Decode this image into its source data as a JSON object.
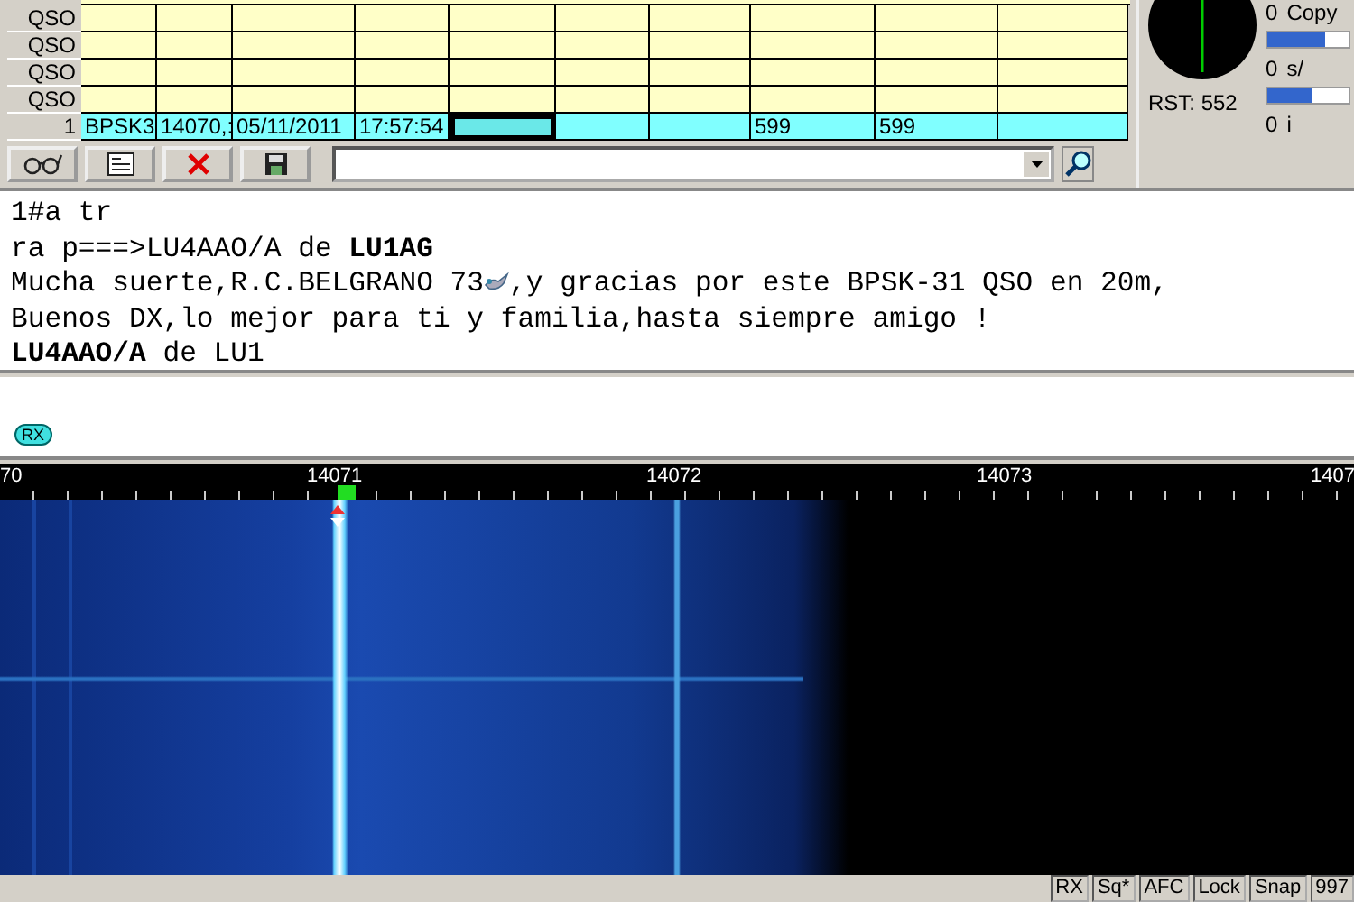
{
  "log_grid": {
    "rows": [
      {
        "label": "QSO",
        "selected": false,
        "cells": [
          {},
          {},
          {},
          {},
          {},
          {},
          {},
          {},
          {},
          {}
        ]
      },
      {
        "label": "QSO",
        "selected": false,
        "cells": [
          {},
          {},
          {},
          {},
          {},
          {},
          {},
          {},
          {},
          {}
        ]
      },
      {
        "label": "QSO",
        "selected": false,
        "cells": [
          {},
          {},
          {},
          {},
          {},
          {},
          {},
          {},
          {},
          {}
        ]
      },
      {
        "label": "QSO",
        "selected": false,
        "cells": [
          {},
          {},
          {},
          {},
          {},
          {},
          {},
          {},
          {},
          {}
        ]
      },
      {
        "label": "1",
        "selected": true,
        "cells": [
          {
            "text": "BPSK3",
            "focused": false
          },
          {
            "text": "14070,:",
            "focused": false
          },
          {
            "text": "05/11/2011",
            "focused": false
          },
          {
            "text": "17:57:54",
            "focused": false
          },
          {
            "focused": true
          },
          {
            "focused": false
          },
          {
            "focused": false
          },
          {
            "text": "599",
            "focused": false
          },
          {
            "text": "599",
            "focused": false
          },
          {
            "focused": false
          }
        ]
      }
    ]
  },
  "scope_panel": {
    "rst": "RST: 552",
    "meters": [
      {
        "label": "Copy",
        "reading": "0",
        "level": 0.7
      },
      {
        "label": "s/",
        "reading": "0",
        "level": 0.55
      },
      {
        "label": "i",
        "reading": "0"
      }
    ]
  },
  "toolbar": {
    "buttons": [
      {
        "kind": "glasses"
      },
      {
        "kind": "card"
      },
      {
        "kind": "delete"
      },
      {
        "kind": "save"
      }
    ]
  },
  "rx_text": {
    "lines": [
      {
        "parts": [
          {
            "text": "1#a tr"
          }
        ]
      },
      {
        "parts": [
          {
            "text": "ra p===>LU4AAO/A de **LU1AG**"
          }
        ]
      },
      {
        "parts": [
          {
            "text": "Mucha suerte,R.C.BELGRANO 73"
          },
          {
            "kind": "emoji"
          },
          {
            "text": ",y gracias por este BPSK-31 QSO en 20m,"
          }
        ]
      },
      {
        "parts": [
          {
            "text": "Buenos DX,lo mejor para ti y familia,hasta siempre amigo !"
          }
        ]
      },
      {
        "parts": [
          {
            "text": "**LU4AAO/A** de LU1"
          }
        ]
      }
    ]
  },
  "tx_area": {
    "mode_badge": "RX"
  },
  "waterfall": {
    "scale": [
      "70",
      "14071",
      "14072",
      "14073",
      "1407"
    ]
  },
  "status_bar": {
    "fields": [
      "RX",
      "Sq*",
      "AFC",
      "Lock",
      "Snap",
      "997"
    ]
  }
}
